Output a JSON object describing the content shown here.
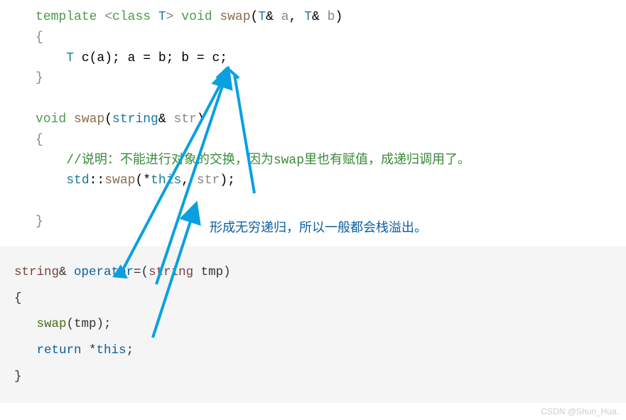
{
  "code1": {
    "l1_template": "template",
    "l1_lt": "<",
    "l1_class": "class",
    "l1_T": " T",
    "l1_gt": ">",
    "l1_void": " void",
    "l1_swap": " swap",
    "l1_open": "(",
    "l1_T2": "T",
    "l1_amp1": "&",
    "l1_a": " a",
    "l1_comma": ",",
    "l1_T3": "  T",
    "l1_amp2": "&",
    "l1_b": " b",
    "l1_close": ")",
    "l2_brace_open": "{",
    "l3_indent": "    ",
    "l3_T": "T",
    "l3_body": " c(a); a = b; b = c;",
    "l4_brace_close": "}",
    "l6_void": "void",
    "l6_swap": " swap",
    "l6_open": "(",
    "l6_string": "string",
    "l6_amp": "&",
    "l6_str": " str",
    "l6_close": ")",
    "l7_brace_open": "{",
    "l8_indent": "    ",
    "l8_comment": "//说明：不能进行对象的交换，因为swap里也有赋值，成递归调用了。",
    "l9_indent": "    ",
    "l9_std": "std",
    "l9_colons": "::",
    "l9_swap": "swap",
    "l9_open": "(",
    "l9_star": "*",
    "l9_this": "this",
    "l9_comma": ",",
    "l9_str": " str",
    "l9_close": ")",
    "l9_semi": ";",
    "l11_brace_close": "}"
  },
  "code2": {
    "l1_string": "string",
    "l1_amp": "&",
    "l1_operator": " operator",
    "l1_eq": "=(",
    "l1_string2": "string",
    "l1_tmp": " tmp)",
    "l2_brace_open": "{",
    "l3_indent": "   ",
    "l3_swap": "swap",
    "l3_args": "(tmp);",
    "l4_indent": "   ",
    "l4_return": "return",
    "l4_star": " *",
    "l4_this": "this",
    "l4_semi": ";",
    "l5_brace_close": "}"
  },
  "annotation": "形成无穷递归，所以一般都会栈溢出。",
  "watermark": "CSDN @Shun_Hua."
}
